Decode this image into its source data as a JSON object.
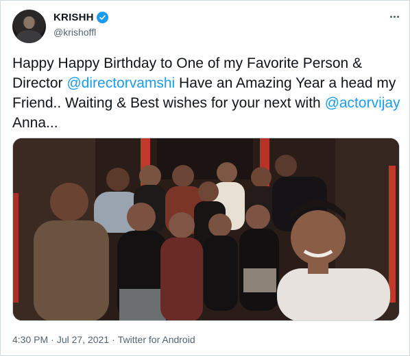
{
  "user": {
    "display_name": "KRISHH",
    "handle": "@krishoffl",
    "avatar_icon": "profile-photo",
    "verified_icon": "verified-badge-icon",
    "verified_color": "#1d9bf0"
  },
  "menu": {
    "icon": "more-horizontal-icon"
  },
  "tweet": {
    "text_1": "Happy Happy Birthday to One of my Favorite Person & Director ",
    "mention_1": "@directorvamshi",
    "text_2": " Have an Amazing Year a head my Friend.. Waiting & Best wishes for your next with ",
    "mention_2": "@actorvijay",
    "text_3": " Anna...",
    "link_color": "#1d9bf0"
  },
  "media": {
    "type": "group-selfie-photo"
  },
  "meta": {
    "time": "4:30 PM",
    "separator": "·",
    "date": "Jul 27, 2021",
    "source": "Twitter for Android"
  }
}
